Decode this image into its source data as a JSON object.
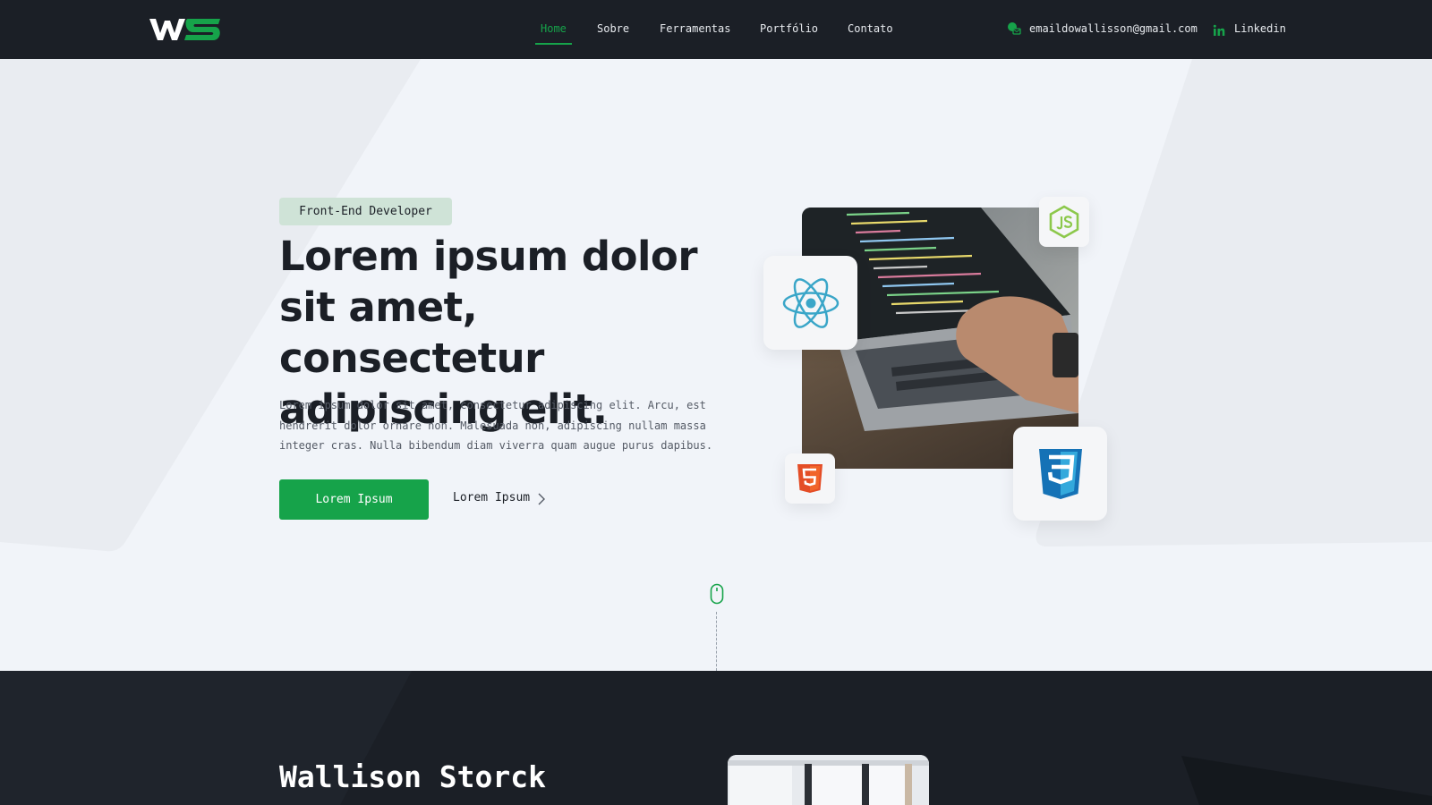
{
  "header": {
    "logo": {
      "text": "WS",
      "icon": "ws-logo"
    },
    "nav": [
      {
        "label": "Home",
        "active": true
      },
      {
        "label": "Sobre",
        "active": false
      },
      {
        "label": "Ferramentas",
        "active": false
      },
      {
        "label": "Portfólio",
        "active": false
      },
      {
        "label": "Contato",
        "active": false
      }
    ],
    "email": {
      "label": "emaildowallisson@gmail.com",
      "icon": "email-icon"
    },
    "linkedin": {
      "label": "Linkedin",
      "icon": "linkedin-icon"
    }
  },
  "hero": {
    "badge": "Front-End Developer",
    "title": "Lorem ipsum dolor sit amet, consectetur adipiscing elit.",
    "text": "Lorem ipsum dolor sit amet, consectetur adipiscing elit. Arcu, est hendrerit dolor ornare non. Malesuada non, adipiscing nullam massa integer cras. Nulla bibendum diam viverra quam augue purus dapibus.",
    "primary_button": "Lorem Ipsum",
    "secondary_button": "Lorem Ipsum",
    "tech_icons": [
      "react-icon",
      "nodejs-icon",
      "html5-icon",
      "css3-icon"
    ]
  },
  "about": {
    "name": "Wallison Storck"
  },
  "colors": {
    "accent": "#16a34a",
    "dark": "#1b1f26",
    "background": "#f1f4f9"
  }
}
